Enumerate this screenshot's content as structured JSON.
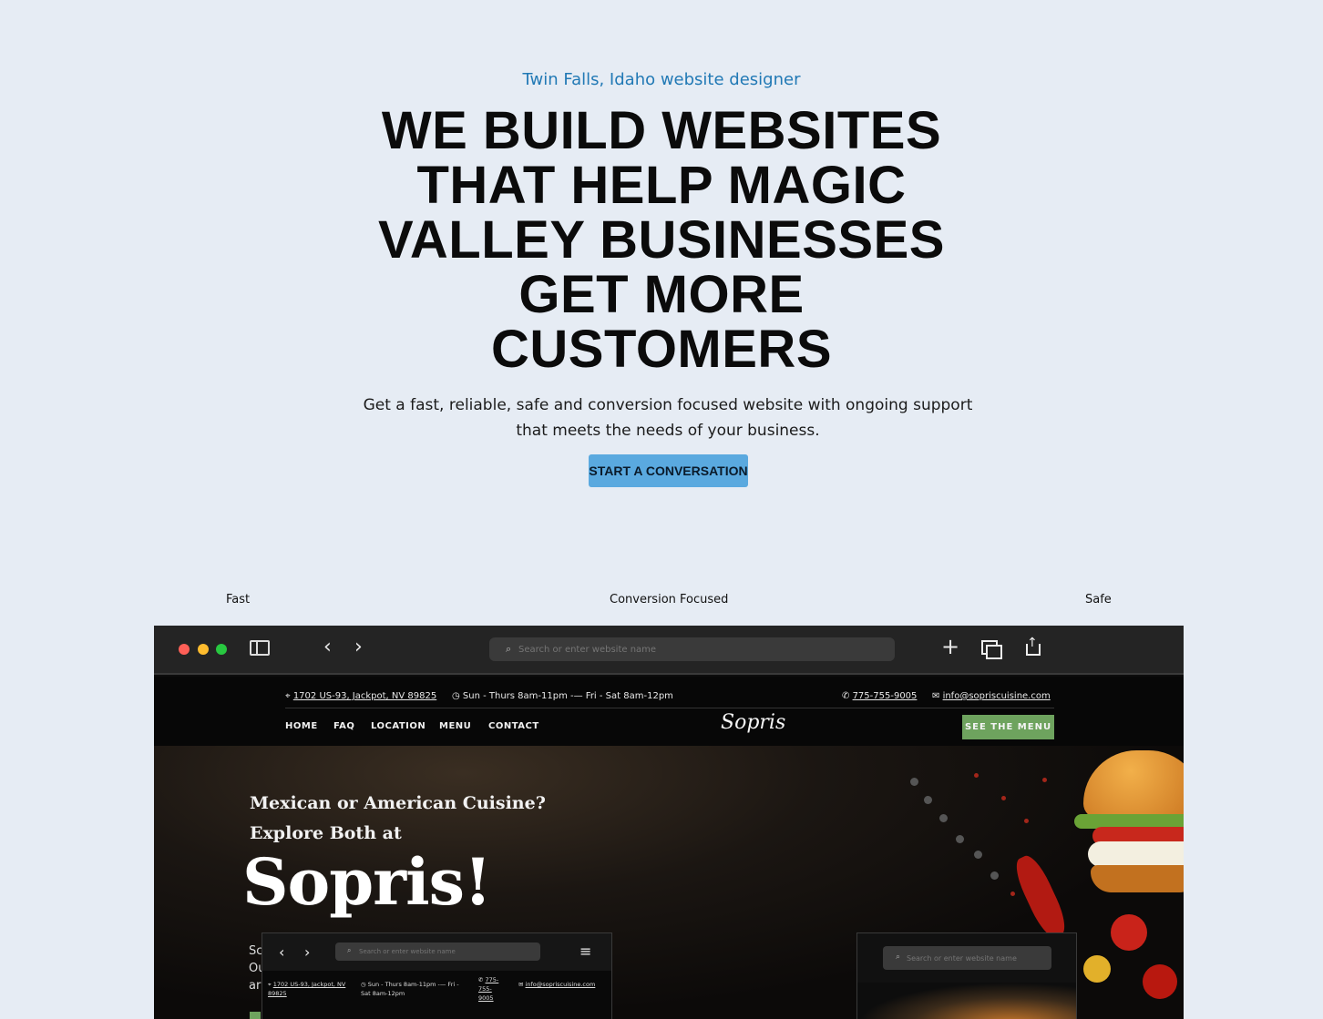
{
  "hero": {
    "eyebrow": "Twin Falls, Idaho website designer",
    "headline": "WE BUILD WEBSITES THAT HELP MAGIC VALLEY BUSINESSES GET MORE CUSTOMERS",
    "subcopy": "Get a fast, reliable, safe and conversion focused website with ongoing support that meets the needs of your business.",
    "cta_label": "START A CONVERSATION"
  },
  "features": [
    "Fast",
    "Conversion Focused",
    "Safe"
  ],
  "colors": {
    "background": "#e6ecf4",
    "accent": "#5aa9df",
    "eyebrow": "#2179b5",
    "site_green": "#6ea35e"
  },
  "browser": {
    "url_placeholder": "Search or enter website name",
    "icons": [
      "sidebar-icon",
      "back-icon",
      "forward-icon",
      "search-icon",
      "plus-icon",
      "tabs-icon",
      "share-icon"
    ]
  },
  "site": {
    "address": "1702 US-93, Jackpot, NV 89825",
    "hours": "Sun - Thurs 8am-11pm -— Fri - Sat 8am-12pm",
    "phone": "775-755-9005",
    "email": "info@sopriscuisine.com",
    "nav": [
      "HOME",
      "FAQ",
      "LOCATION",
      "MENU",
      "CONTACT"
    ],
    "logo": "Sopris",
    "menu_button": "SEE THE MENU",
    "hero_line1": "Mexican or American Cuisine?",
    "hero_line2": "Explore Both at",
    "hero_big": "Sopris!",
    "fragments": [
      "Sc",
      "Ou",
      "ar"
    ]
  },
  "tablet": {
    "url_placeholder": "Search or enter website name",
    "address": "1702 US-93, Jackpot, NV 89825",
    "hours": "Sun - Thurs 8am-11pm -— Fri - Sat 8am-12pm",
    "phone": "775-755-9005",
    "email": "info@sopriscuisine.com"
  },
  "phone": {
    "url_placeholder": "Search or enter website name"
  }
}
